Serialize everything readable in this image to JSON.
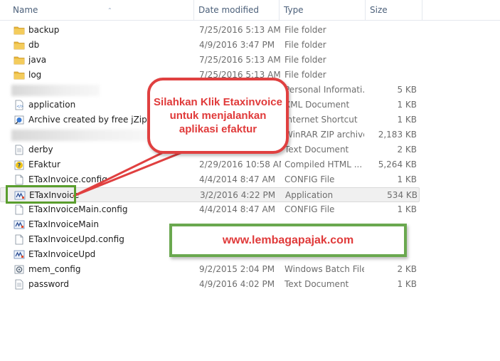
{
  "columns": {
    "name": "Name",
    "date_modified": "Date modified",
    "type": "Type",
    "size": "Size"
  },
  "files": [
    {
      "name": "backup",
      "date": "7/25/2016 5:13 AM",
      "type": "File folder",
      "size": "",
      "icon": "folder-icon"
    },
    {
      "name": "db",
      "date": "4/9/2016 3:47 PM",
      "type": "File folder",
      "size": "",
      "icon": "folder-icon"
    },
    {
      "name": "java",
      "date": "7/25/2016 5:13 AM",
      "type": "File folder",
      "size": "",
      "icon": "folder-icon"
    },
    {
      "name": "log",
      "date": "7/25/2016 5:13 AM",
      "type": "File folder",
      "size": "",
      "icon": "folder-icon"
    },
    {
      "name": "",
      "date": "",
      "type": "Personal Informati...",
      "size": "5 KB",
      "icon": "blurred"
    },
    {
      "name": "application",
      "date": "",
      "type": "XML Document",
      "size": "1 KB",
      "icon": "xml-file-icon"
    },
    {
      "name": "Archive created by free jZip",
      "date": "",
      "type": "Internet Shortcut",
      "size": "1 KB",
      "icon": "shortcut-icon"
    },
    {
      "name": "",
      "date": "",
      "type": "WinRAR ZIP archive",
      "size": "2,183 KB",
      "icon": "blurred"
    },
    {
      "name": "derby",
      "date": "",
      "type": "Text Document",
      "size": "2 KB",
      "icon": "text-file-icon"
    },
    {
      "name": "EFaktur",
      "date": "2/29/2016 10:58 AM",
      "type": "Compiled HTML ...",
      "size": "5,264 KB",
      "icon": "help-file-icon"
    },
    {
      "name": "ETaxInvoice.config",
      "date": "4/4/2014 8:47 AM",
      "type": "CONFIG File",
      "size": "1 KB",
      "icon": "blank-file-icon"
    },
    {
      "name": "ETaxInvoice",
      "date": "3/2/2016 4:22 PM",
      "type": "Application",
      "size": "534 KB",
      "icon": "app-icon"
    },
    {
      "name": "ETaxInvoiceMain.config",
      "date": "4/4/2014 8:47 AM",
      "type": "CONFIG File",
      "size": "1 KB",
      "icon": "blank-file-icon"
    },
    {
      "name": "ETaxInvoiceMain",
      "date": "",
      "type": "",
      "size": "",
      "icon": "app-icon"
    },
    {
      "name": "ETaxInvoiceUpd.config",
      "date": "",
      "type": "",
      "size": "",
      "icon": "blank-file-icon"
    },
    {
      "name": "ETaxInvoiceUpd",
      "date": "",
      "type": "",
      "size": "",
      "icon": "app-icon"
    },
    {
      "name": "mem_config",
      "date": "9/2/2015 2:04 PM",
      "type": "Windows Batch File",
      "size": "2 KB",
      "icon": "batch-file-icon"
    },
    {
      "name": "password",
      "date": "4/9/2016 4:02 PM",
      "type": "Text Document",
      "size": "1 KB",
      "icon": "text-file-icon"
    }
  ],
  "callout": {
    "text": "Silahkan Klik Etaxinvoice untuk menjalankan aplikasi efaktur"
  },
  "banner": {
    "text": "www.lembagapajak.com"
  },
  "colors": {
    "callout": "#e04040",
    "highlight": "#5a9e2e",
    "banner_border": "#6aa84f",
    "folder": "#e8b83a"
  }
}
